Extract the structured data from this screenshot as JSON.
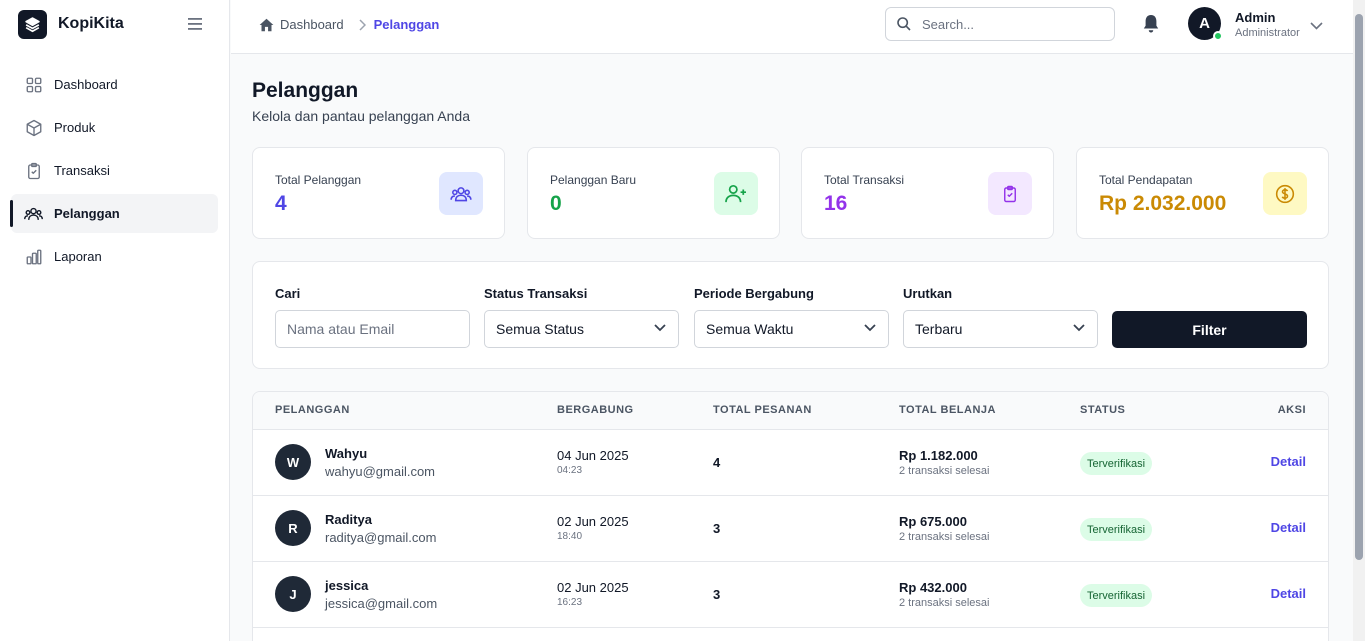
{
  "brand": {
    "name": "KopiKita"
  },
  "sidebar": {
    "items": [
      {
        "label": "Dashboard",
        "icon": "grid-icon",
        "active": false
      },
      {
        "label": "Produk",
        "icon": "box-icon",
        "active": false
      },
      {
        "label": "Transaksi",
        "icon": "clipboard-icon",
        "active": false
      },
      {
        "label": "Pelanggan",
        "icon": "users-icon",
        "active": true
      },
      {
        "label": "Laporan",
        "icon": "bar-chart-icon",
        "active": false
      }
    ]
  },
  "header": {
    "breadcrumb": {
      "home": "Dashboard",
      "current": "Pelanggan"
    },
    "search_placeholder": "Search...",
    "user": {
      "initial": "A",
      "name": "Admin",
      "role": "Administrator"
    }
  },
  "page": {
    "title": "Pelanggan",
    "subtitle": "Kelola dan pantau pelanggan Anda"
  },
  "stats": [
    {
      "label": "Total Pelanggan",
      "value": "4",
      "color": "#4f46e5",
      "icon_bg": "#e0e7ff",
      "icon": "users-icon"
    },
    {
      "label": "Pelanggan Baru",
      "value": "0",
      "color": "#16a34a",
      "icon_bg": "#dcfce7",
      "icon": "user-plus-icon"
    },
    {
      "label": "Total Transaksi",
      "value": "16",
      "color": "#9333ea",
      "icon_bg": "#f3e8ff",
      "icon": "clipboard-check-icon"
    },
    {
      "label": "Total Pendapatan",
      "value": "Rp 2.032.000",
      "color": "#ca8a04",
      "icon_bg": "#fef9c3",
      "icon": "dollar-circle-icon"
    }
  ],
  "filters": {
    "search": {
      "label": "Cari",
      "placeholder": "Nama atau Email"
    },
    "status": {
      "label": "Status Transaksi",
      "value": "Semua Status"
    },
    "period": {
      "label": "Periode Bergabung",
      "value": "Semua Waktu"
    },
    "sort": {
      "label": "Urutkan",
      "value": "Terbaru"
    },
    "button": "Filter"
  },
  "table": {
    "headers": [
      "PELANGGAN",
      "BERGABUNG",
      "TOTAL PESANAN",
      "TOTAL BELANJA",
      "STATUS",
      "AKSI"
    ],
    "rows": [
      {
        "initial": "W",
        "name": "Wahyu",
        "email": "wahyu@gmail.com",
        "date": "04 Jun 2025",
        "time": "04:23",
        "orders": "4",
        "spend": "Rp 1.182.000",
        "spend_sub": "2 transaksi selesai",
        "status": "Terverifikasi",
        "action": "Detail"
      },
      {
        "initial": "R",
        "name": "Raditya",
        "email": "raditya@gmail.com",
        "date": "02 Jun 2025",
        "time": "18:40",
        "orders": "3",
        "spend": "Rp 675.000",
        "spend_sub": "2 transaksi selesai",
        "status": "Terverifikasi",
        "action": "Detail"
      },
      {
        "initial": "J",
        "name": "jessica",
        "email": "jessica@gmail.com",
        "date": "02 Jun 2025",
        "time": "16:23",
        "orders": "3",
        "spend": "Rp 432.000",
        "spend_sub": "2 transaksi selesai",
        "status": "Terverifikasi",
        "action": "Detail"
      }
    ]
  }
}
